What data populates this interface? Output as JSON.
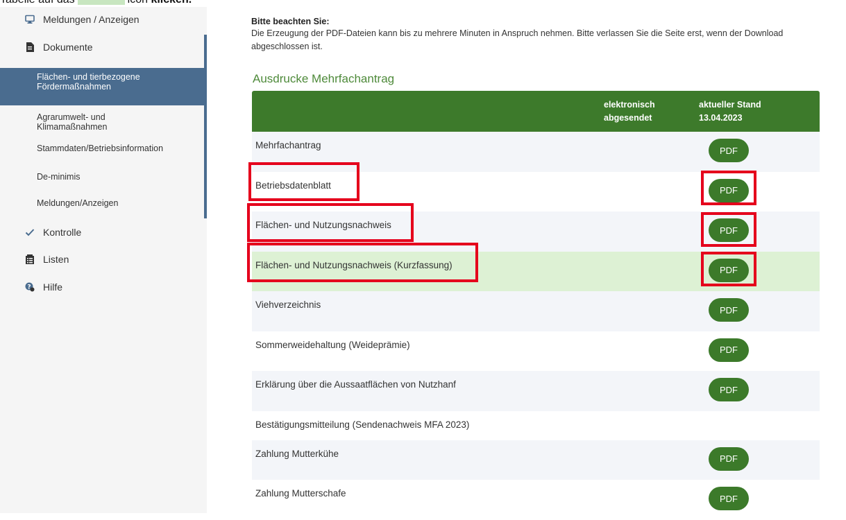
{
  "top_cut": {
    "before": "Tabelle auf das",
    "after": "icon",
    "bold": "klicken."
  },
  "sidebar": {
    "items": [
      {
        "label": "Meldungen / Anzeigen",
        "icon": "monitor-icon"
      },
      {
        "label": "Dokumente",
        "icon": "document-icon"
      },
      {
        "label": "Kontrolle",
        "icon": "check-icon"
      },
      {
        "label": "Listen",
        "icon": "list-icon"
      },
      {
        "label": "Hilfe",
        "icon": "help-icon"
      }
    ],
    "sub_items": [
      {
        "label": "Flächen- und tierbezogene Fördermaßnahmen"
      },
      {
        "label": "Agrarumwelt- und Klimamaßnahmen"
      },
      {
        "label": "Stammdaten/Betriebsinformation"
      },
      {
        "label": "De-minimis"
      },
      {
        "label": "Meldungen/Anzeigen"
      }
    ]
  },
  "notice": {
    "title": "Bitte beachten Sie:",
    "body": "Die Erzeugung der PDF-Dateien kann bis zu mehrere Minuten in Anspruch nehmen. Bitte verlassen Sie die Seite erst, wenn der Download abgeschlossen ist."
  },
  "section_title": "Ausdrucke Mehrfachantrag",
  "table": {
    "col1": "elektronisch abgesendet",
    "col2": "aktueller Stand 13.04.2023",
    "pdf_label": "PDF",
    "rows": [
      {
        "label": "Mehrfachantrag",
        "pdf": true
      },
      {
        "label": "Betriebsdatenblatt",
        "pdf": true
      },
      {
        "label": "Flächen- und Nutzungsnachweis",
        "pdf": true
      },
      {
        "label": "Flächen- und Nutzungsnachweis (Kurzfassung)",
        "pdf": true
      },
      {
        "label": "Viehverzeichnis",
        "pdf": true
      },
      {
        "label": "Sommerweidehaltung (Weideprämie)",
        "pdf": true
      },
      {
        "label": "Erklärung über die Aussaatflächen von Nutzhanf",
        "pdf": true
      },
      {
        "label": "Bestätigungsmitteilung (Sendenachweis MFA 2023)",
        "pdf": false
      },
      {
        "label": "Zahlung Mutterkühe",
        "pdf": true
      },
      {
        "label": "Zahlung Mutterschafe",
        "pdf": true
      }
    ]
  },
  "colors": {
    "sidebar_active": "#4a6c8f",
    "header_green": "#3d7a2b",
    "highlight_row": "#ddf1d4",
    "annotation_red": "#e5001c"
  }
}
